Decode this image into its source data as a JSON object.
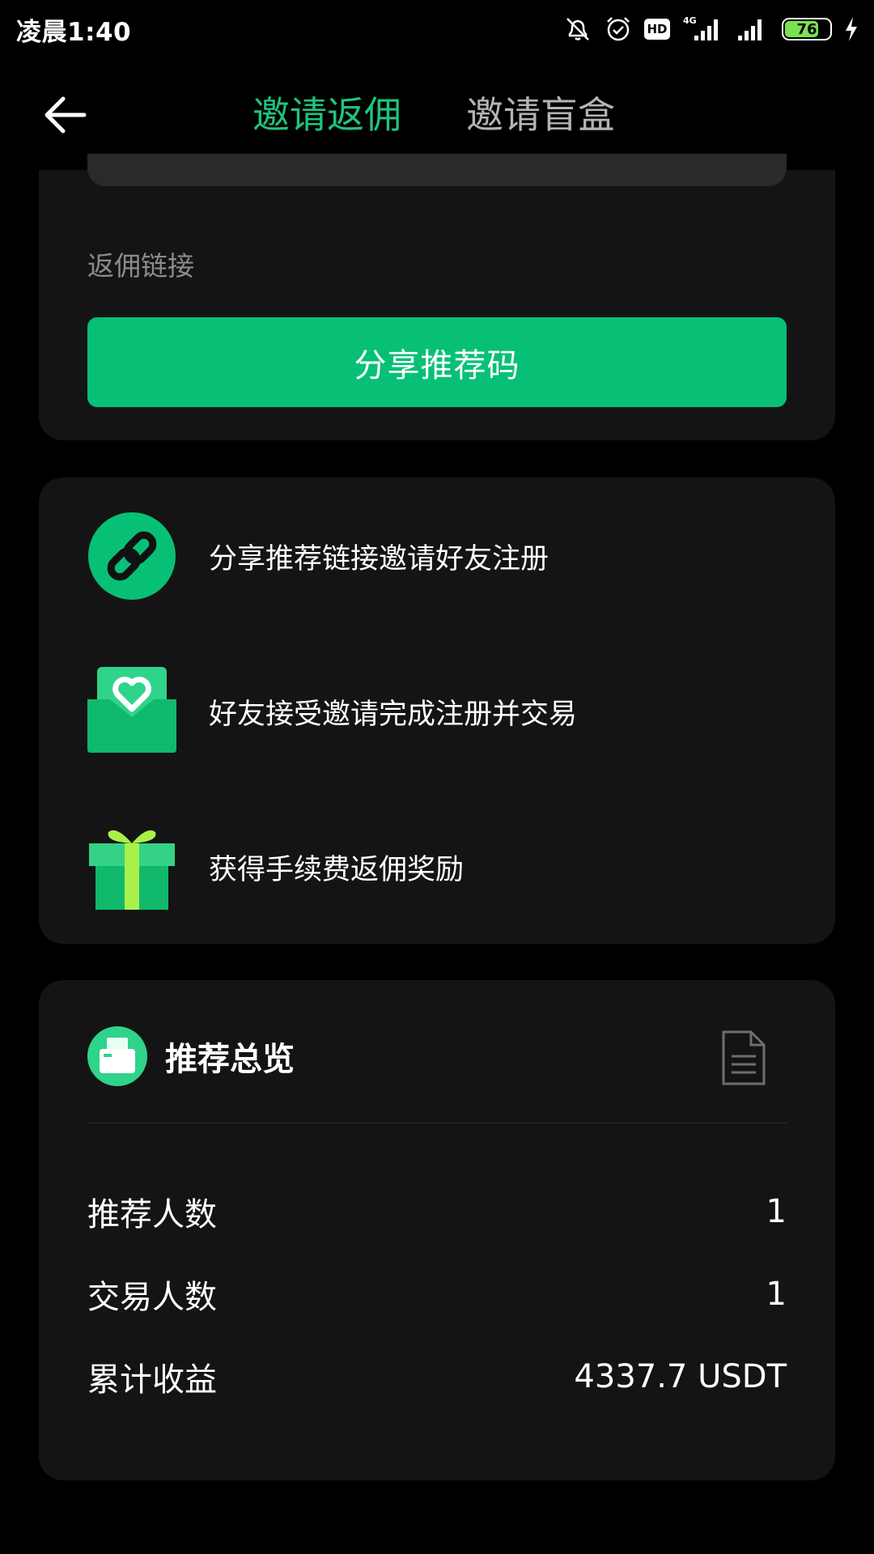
{
  "status_bar": {
    "time": "凌晨1:40",
    "hd": "HD",
    "network": "4G",
    "battery": "76",
    "battery_level": 0.76,
    "battery_color": "#7be052"
  },
  "header": {
    "tabs": [
      {
        "label": "邀请返佣",
        "active": true
      },
      {
        "label": "邀请盲盒",
        "active": false
      }
    ],
    "accent": "#1fc47c"
  },
  "link_section": {
    "label": "返佣链接",
    "share_button": "分享推荐码",
    "button_color": "#07c076"
  },
  "steps": [
    {
      "icon": "link-icon",
      "text": "分享推荐链接邀请好友注册"
    },
    {
      "icon": "heart-envelope-icon",
      "text": "好友接受邀请完成注册并交易"
    },
    {
      "icon": "gift-icon",
      "text": "获得手续费返佣奖励"
    }
  ],
  "overview": {
    "title": "推荐总览",
    "logo_icon": "wallet-icon",
    "records_icon": "document-icon",
    "rows": [
      {
        "label": "推荐人数",
        "value": "1"
      },
      {
        "label": "交易人数",
        "value": "1"
      },
      {
        "label": "累计收益",
        "value": "4337.7 USDT"
      }
    ]
  }
}
